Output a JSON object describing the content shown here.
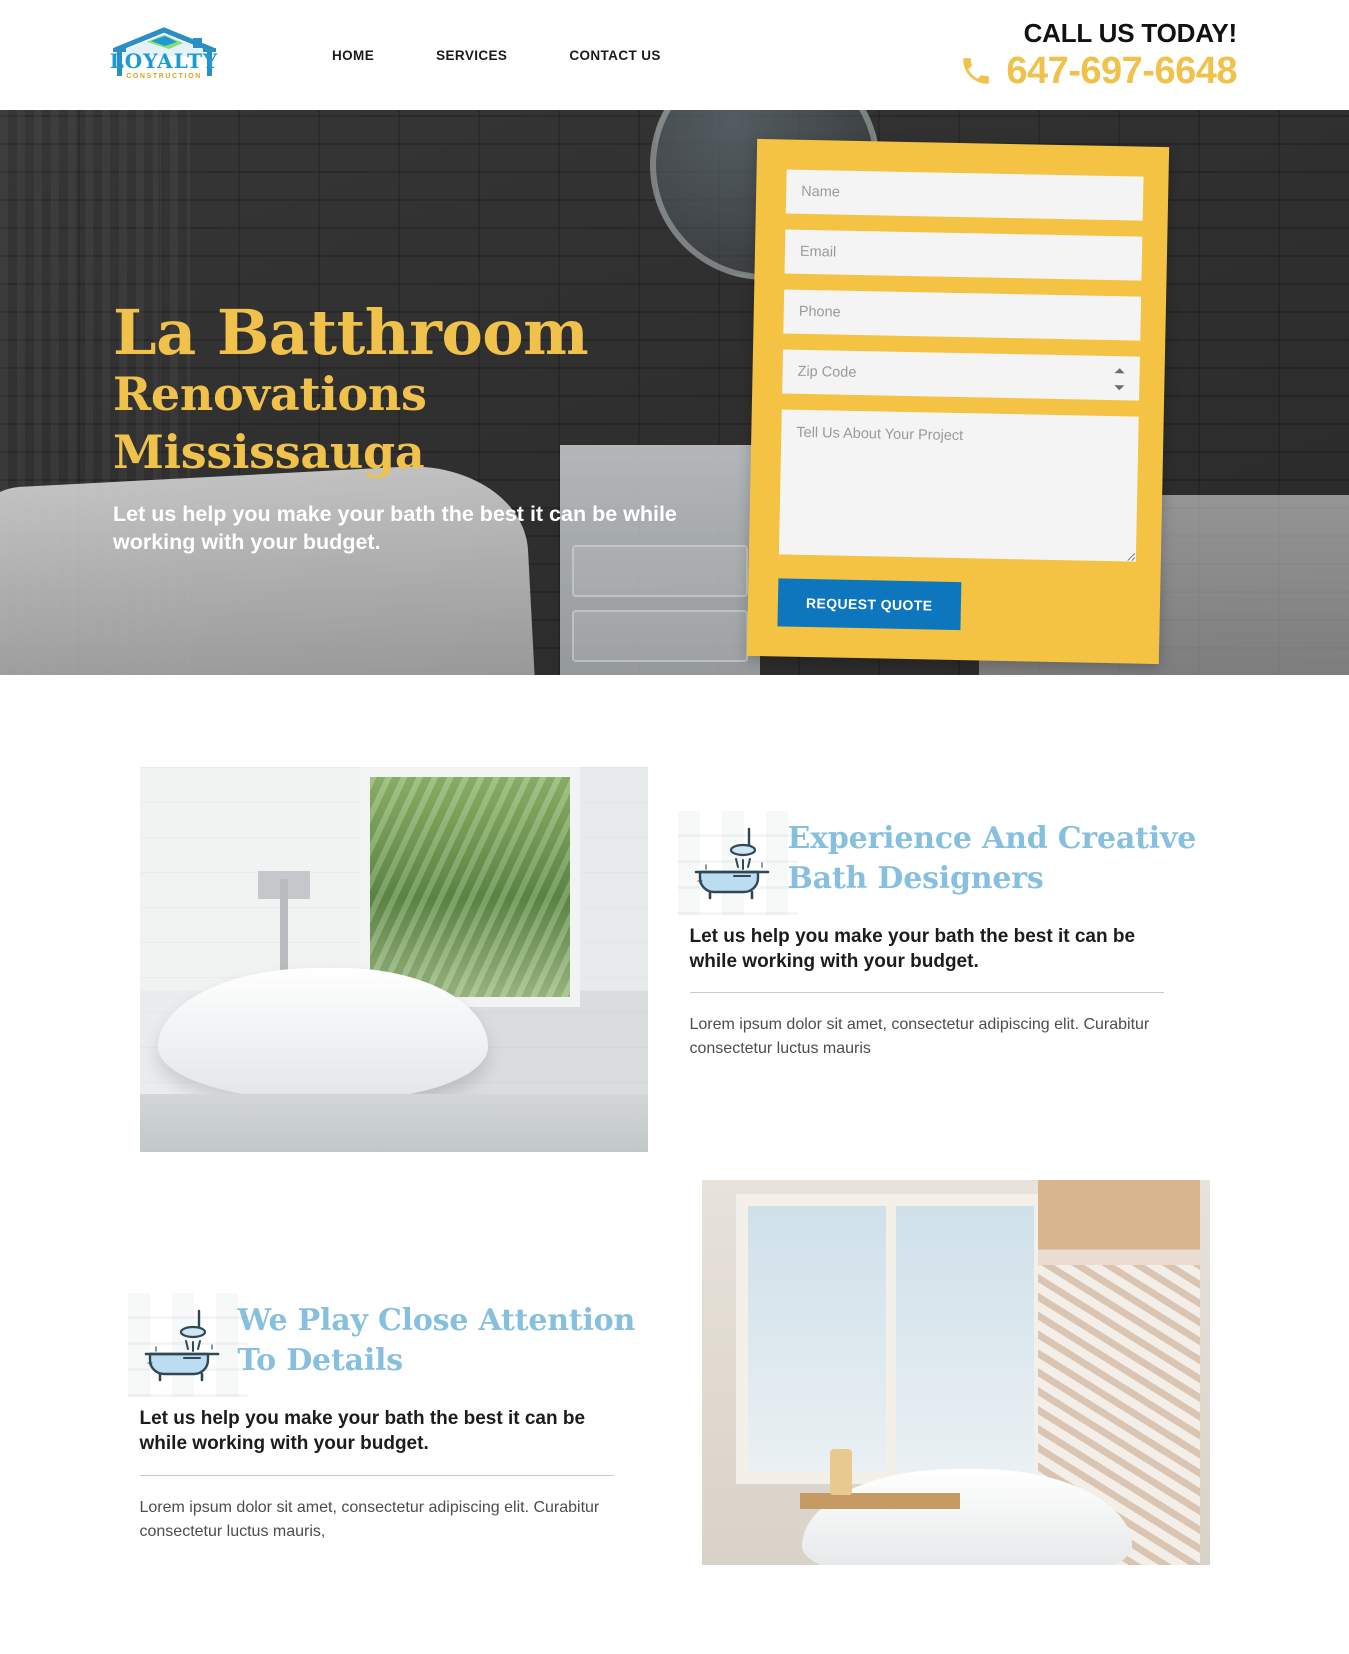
{
  "header": {
    "logo": {
      "brand": "LOYALTY",
      "sub": "CONSTRUCTION"
    },
    "nav": [
      {
        "label": "HOME"
      },
      {
        "label": "SERVICES"
      },
      {
        "label": "CONTACT US"
      }
    ],
    "call": {
      "label": "CALL US TODAY!",
      "number": "647-697-6648"
    }
  },
  "hero": {
    "title_line1": "La Batthroom",
    "title_line2": "Renovations Mississauga",
    "subtitle": "Let us help you make your bath the best it can be while working with your budget."
  },
  "quote_form": {
    "name_placeholder": "Name",
    "email_placeholder": "Email",
    "phone_placeholder": "Phone",
    "zip_placeholder": "Zip Code",
    "message_placeholder": "Tell Us About Your Project",
    "name_value": "",
    "email_value": "",
    "phone_value": "",
    "zip_value": "",
    "message_value": "",
    "submit_label": "REQUEST QUOTE"
  },
  "features": [
    {
      "title": "Experience And Creative Bath Designers",
      "lead": "Let us help you make your bath the best it can be while working with your budget.",
      "body": "Lorem ipsum dolor sit amet, consectetur adipiscing elit. Curabitur consectetur luctus mauris"
    },
    {
      "title": "We Play Close Attention To Details",
      "lead": "Let us help you make your bath the best it can be while working with your budget.",
      "body": "Lorem ipsum dolor sit amet, consectetur adipiscing elit. Curabitur consectetur luctus mauris,"
    }
  ],
  "colors": {
    "accent_yellow": "#f4c343",
    "accent_gold_text": "#f0c14b",
    "accent_blue": "#0e76bc",
    "heading_blue": "#86c0de",
    "logo_blue": "#1c9ad6"
  }
}
